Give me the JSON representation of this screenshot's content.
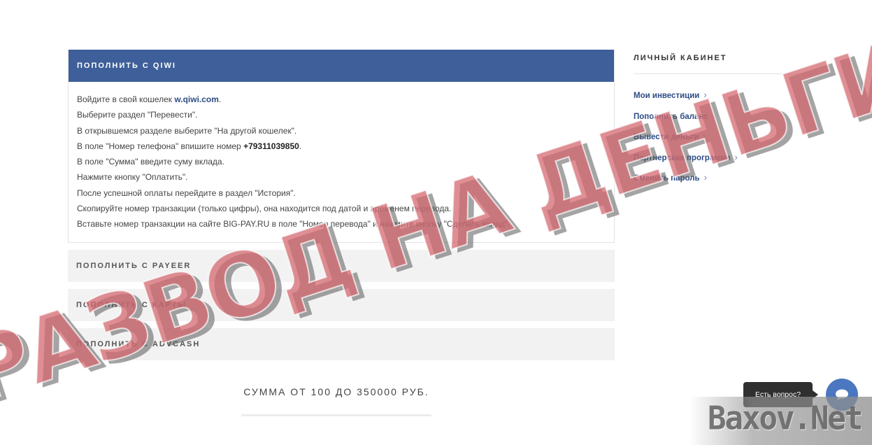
{
  "qiwi_panel": {
    "title": "ПОПОЛНИТЬ С QIWI",
    "lines": [
      {
        "pre": "Войдите в свой кошелек ",
        "link": "w.qiwi.com",
        "post": "."
      },
      {
        "text": "Выберите раздел \"Перевести\"."
      },
      {
        "text": "В открывшемся разделе выберите \"На другой кошелек\"."
      },
      {
        "pre": "В поле \"Номер телефона\" впишите номер ",
        "bold": "+79311039850",
        "post": "."
      },
      {
        "text": "В поле \"Сумма\" введите суму вклада."
      },
      {
        "text": "Нажмите кнопку \"Оплатить\"."
      },
      {
        "text": "После успешной оплаты перейдите в раздел \"История\"."
      },
      {
        "text": "Скопируйте номер транзакции (только цифры), она находится под датой и временем перевода."
      },
      {
        "text": "Вставьте номер транзакции на сайте BIG-PAY.RU в поле \"Номер перевода\" и нажмите кнопку \"Сделать вклад\"."
      }
    ]
  },
  "other_panels": [
    "ПОПОЛНИТЬ С PAYEER",
    "ПОПОЛНИТЬ С КАРТЫ",
    "ПОПОЛНИТЬ С ADVCASH"
  ],
  "amount_note": "СУММА ОТ 100 ДО 350000 РУБ.",
  "sidebar": {
    "title": "ЛИЧНЫЙ КАБИНЕТ",
    "items": [
      {
        "label": "Мои инвестиции"
      },
      {
        "label": "Пополнить баланс"
      },
      {
        "label": "Вывести деньги"
      },
      {
        "label": "Партнерская программа"
      },
      {
        "label": "Сменить пароль"
      }
    ],
    "chevron": "›"
  },
  "overlay_stamp": "РАЗВОД НА ДЕНЬГИ",
  "chat": {
    "bubble_text": "Есть вопрос?",
    "icon": "chat-icon"
  },
  "watermark": "Baxov.Net",
  "colors": {
    "header_blue": "#3e5f99",
    "link_blue": "#2d4c86",
    "stamp_red": "#d46970"
  }
}
